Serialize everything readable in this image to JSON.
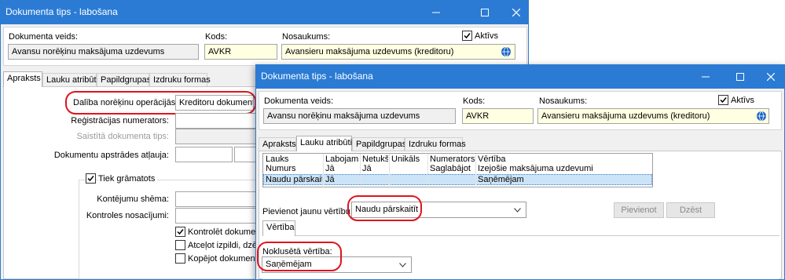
{
  "back_window": {
    "title": "Dokumenta tips - labošana",
    "controls": {
      "minimize": "–",
      "maximize": "□",
      "close": "✕"
    },
    "doc_type_label": "Dokumenta veids:",
    "doc_type_value": "Avansu norēķinu maksājuma uzdevums",
    "code_label": "Kods:",
    "code_value": "AVKR",
    "name_label": "Nosaukums:",
    "name_value": "Avansieru maksājuma uzdevums (kreditoru)",
    "active_label": "Aktīvs",
    "active_checked": true,
    "tabs": [
      "Apraksts",
      "Lauku atribūti",
      "Papildgrupas",
      "Izdruku formas"
    ],
    "active_tab": "Apraksts",
    "fields": {
      "section_label": "Dalība norēķinu operācijās:",
      "section_value": "Kreditoru dokuments",
      "reg_numerator_label": "Reģistrācijas numerators:",
      "linked_doc_type_label": "Saistītā dokumenta tips:",
      "processing_label": "Dokumentu apstrādes atļauja:"
    },
    "booking": {
      "label": "Tiek grāmatots",
      "checked": true,
      "scheme_label": "Kontējumu shēma:",
      "control_label": "Kontroles nosacījumi:",
      "opt1": "Kontrolēt dokumenta",
      "opt2": "Atceļot izpildi, dzēst",
      "opt3": "Kopējot dokumentu, "
    }
  },
  "front_window": {
    "title": "Dokumenta tips - labošana",
    "controls": {
      "minimize": "–",
      "maximize": "□",
      "close": "✕"
    },
    "doc_type_label": "Dokumenta veids:",
    "doc_type_value": "Avansu norēķinu maksājuma uzdevums",
    "code_label": "Kods:",
    "code_value": "AVKR",
    "name_label": "Nosaukums:",
    "name_value": "Avansieru maksājuma uzdevums (kreditoru)",
    "active_label": "Aktīvs",
    "active_checked": true,
    "tabs": [
      "Apraksts",
      "Lauku atribūti",
      "Papildgrupas",
      "Izdruku formas"
    ],
    "active_tab": "Lauku atribūti",
    "grid": {
      "columns": [
        "Lauks",
        "Labojams",
        "Netukšs",
        "Unikāls",
        "Numerators",
        "Vērtība"
      ],
      "rows": [
        [
          "Numurs",
          "Jā",
          "Jā",
          "",
          "Saglabājot",
          "Izejošie maksājuma uzdevumi"
        ],
        [
          "Naudu pārskaitīt",
          "Jā",
          "",
          "",
          "",
          "Saņēmējam"
        ]
      ],
      "selected_row": 1
    },
    "add_value_label": "Pievienot jaunu vērtību:",
    "add_value_selected": "Naudu pārskaitīt",
    "add_button": "Pievienot",
    "delete_button": "Dzēst",
    "subtab": "Vērtība",
    "default_value_label": "Noklusētā vērtība:",
    "default_value_selected": "Saņēmējam"
  },
  "colors": {
    "titlebar": "#2b7bd4",
    "highlight": "#e0141e",
    "selection": "#cce4f7",
    "yellow_field": "#ffffe1"
  },
  "icons": {
    "globe": "globe-icon",
    "checkmark": "checkmark-icon",
    "dropdown": "chevron-down-icon"
  }
}
